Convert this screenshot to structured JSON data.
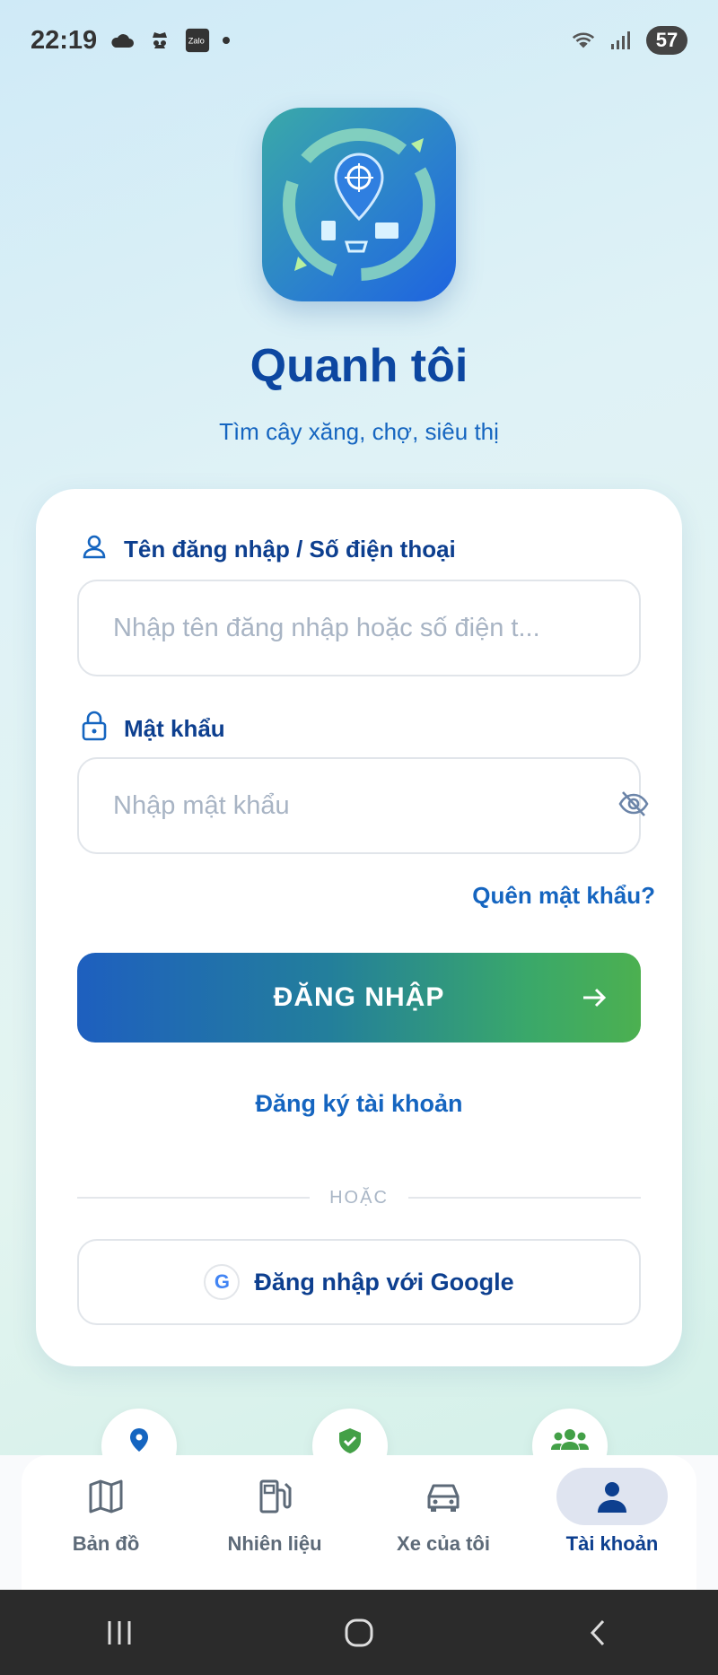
{
  "status_bar": {
    "time": "22:19",
    "battery": "57",
    "left_icons": [
      "cloud-icon",
      "spy-icon",
      "zalo-icon",
      "dot-icon"
    ],
    "right_icons": [
      "wifi-icon",
      "signal-icon",
      "battery-icon"
    ],
    "zalo_text": "Zalo"
  },
  "header": {
    "title": "Quanh tôi",
    "subtitle": "Tìm cây xăng, chợ, siêu thị"
  },
  "login": {
    "username_label": "Tên đăng nhập / Số điện thoại",
    "username_placeholder": "Nhập tên đăng nhập hoặc số điện t...",
    "password_label": "Mật khẩu",
    "password_placeholder": "Nhập mật khẩu",
    "forgot_label": "Quên mật khẩu?",
    "submit_label": "ĐĂNG NHẬP",
    "register_label": "Đăng ký tài khoản",
    "divider_text": "HOẶC",
    "google_letter": "G",
    "google_label": "Đăng nhập với Google"
  },
  "bottom_nav": {
    "items": [
      {
        "label": "Bản đồ",
        "icon": "map-icon",
        "active": false
      },
      {
        "label": "Nhiên liệu",
        "icon": "fuel-icon",
        "active": false
      },
      {
        "label": "Xe của tôi",
        "icon": "car-icon",
        "active": false
      },
      {
        "label": "Tài khoản",
        "icon": "person-icon",
        "active": true
      }
    ]
  },
  "colors": {
    "primary": "#0d47a1",
    "accent_blue": "#1565c0",
    "gradient_start": "#1e5fbf",
    "gradient_end": "#4cb050"
  }
}
